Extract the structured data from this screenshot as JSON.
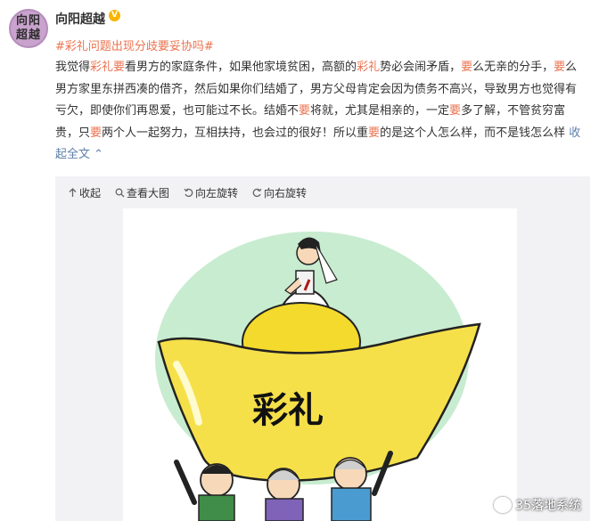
{
  "user": {
    "avatar_line1": "向阳",
    "avatar_line2": "超越",
    "name": "向阳超越",
    "verified_badge": "V"
  },
  "topic": "#彩礼问题出现分歧要妥协吗#",
  "post": {
    "segments": [
      {
        "text": "我觉得",
        "hl": false
      },
      {
        "text": "彩礼",
        "hl": true
      },
      {
        "text": "要",
        "hl": true
      },
      {
        "text": "看男方的家庭条件，如果他家境贫困，高额的",
        "hl": false
      },
      {
        "text": "彩礼",
        "hl": true
      },
      {
        "text": "势必会闹矛盾，",
        "hl": false
      },
      {
        "text": "要",
        "hl": true
      },
      {
        "text": "么无亲的分手，",
        "hl": false
      },
      {
        "text": "要",
        "hl": true
      },
      {
        "text": "么男方家里东拼西凑的借齐，然后如果你们结婚了，男方父母肯定会因为债务不高兴，导致男方也觉得有亏欠，即使你们再恩爱，也可能过不长。结婚不",
        "hl": false
      },
      {
        "text": "要",
        "hl": true
      },
      {
        "text": "将就，尤其是相亲的，一定",
        "hl": false
      },
      {
        "text": "要",
        "hl": true
      },
      {
        "text": "多了解，不管贫穷富贵，只",
        "hl": false
      },
      {
        "text": "要",
        "hl": true
      },
      {
        "text": "两个人一起努力，互相扶持，也会过的很好！所以重",
        "hl": false
      },
      {
        "text": "要",
        "hl": true
      },
      {
        "text": "的是这个人怎么样，而不是钱怎么样 ",
        "hl": false
      }
    ],
    "collapse_label": "收起全文"
  },
  "toolbar": {
    "collapse": "收起",
    "view_large": "查看大图",
    "rotate_left": "向左旋转",
    "rotate_right": "向右旋转"
  },
  "image": {
    "ingot_text": "彩礼",
    "watermark": "35落地系统"
  },
  "colors": {
    "highlight": "#eb7350",
    "link": "#5d7fa8",
    "ingot": "#f6e04a",
    "halo": "#c8ecd0"
  }
}
